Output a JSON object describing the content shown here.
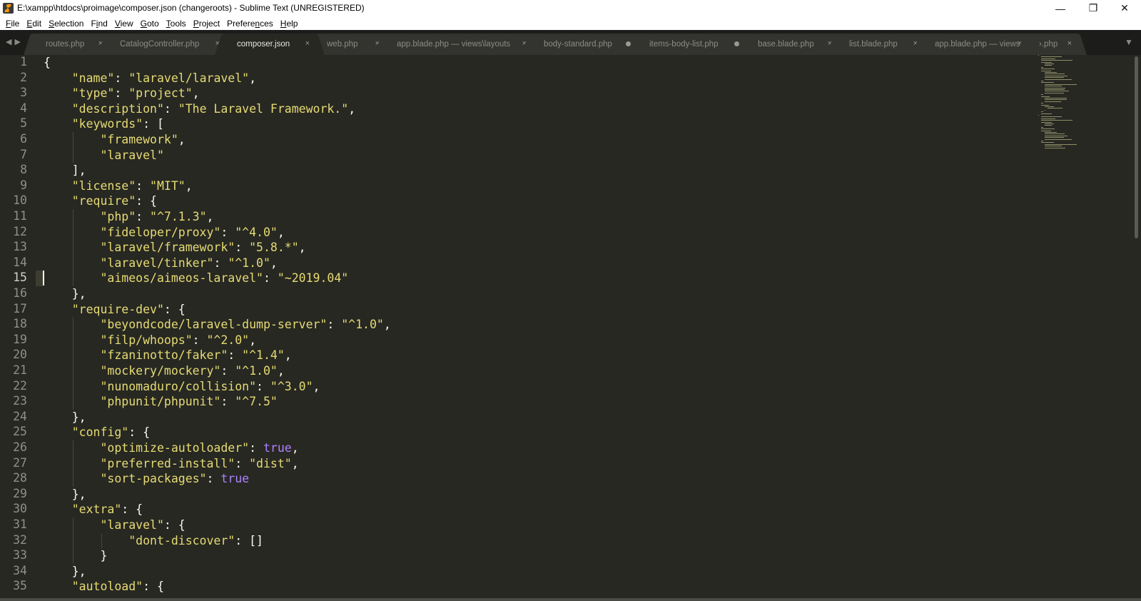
{
  "window": {
    "title": "E:\\xampp\\htdocs\\proimage\\composer.json (changeroots) - Sublime Text (UNREGISTERED)",
    "minimize": "—",
    "maximize": "❐",
    "close": "✕"
  },
  "menu": {
    "items": [
      {
        "u": "F",
        "rest": "ile"
      },
      {
        "u": "E",
        "rest": "dit"
      },
      {
        "u": "S",
        "rest": "election"
      },
      {
        "u": "",
        "pre": "F",
        "u2": "i",
        "rest": "nd"
      },
      {
        "u": "V",
        "rest": "iew"
      },
      {
        "u": "G",
        "rest": "oto"
      },
      {
        "u": "T",
        "rest": "ools"
      },
      {
        "u": "P",
        "rest": "roject"
      },
      {
        "u": "",
        "pre": "Prefere",
        "u2": "n",
        "rest": "ces"
      },
      {
        "u": "H",
        "rest": "elp"
      }
    ]
  },
  "tabs": [
    {
      "label": "routes.php",
      "state": "close",
      "width": 110
    },
    {
      "label": "CatalogController.php",
      "state": "close",
      "width": 170
    },
    {
      "label": "composer.json",
      "state": "close",
      "active": true,
      "width": 132
    },
    {
      "label": "web.php",
      "state": "close",
      "width": 104
    },
    {
      "label": "app.blade.php — views\\layouts",
      "state": "close",
      "width": 212
    },
    {
      "label": "body-standard.php",
      "state": "dirty",
      "width": 154
    },
    {
      "label": "items-body-list.php",
      "state": "dirty",
      "width": 158
    },
    {
      "label": "base.blade.php",
      "state": "close",
      "width": 134
    },
    {
      "label": "list.blade.php",
      "state": "close",
      "width": 126
    },
    {
      "label": "app.blade.php — views",
      "state": "close",
      "width": 152
    },
    {
      "label": "›.php",
      "state": "close",
      "width": 76
    }
  ],
  "tab_icons": {
    "close": "×",
    "left_arrow": "◀",
    "right_arrow": "▶",
    "overflow": "▼"
  },
  "editor": {
    "current_line": 15,
    "lines": [
      [
        [
          "k",
          "{"
        ]
      ],
      [
        [
          "k",
          "    "
        ],
        [
          "s",
          "\"name\""
        ],
        [
          "k",
          ": "
        ],
        [
          "s",
          "\"laravel/laravel\""
        ],
        [
          "k",
          ","
        ]
      ],
      [
        [
          "k",
          "    "
        ],
        [
          "s",
          "\"type\""
        ],
        [
          "k",
          ": "
        ],
        [
          "s",
          "\"project\""
        ],
        [
          "k",
          ","
        ]
      ],
      [
        [
          "k",
          "    "
        ],
        [
          "s",
          "\"description\""
        ],
        [
          "k",
          ": "
        ],
        [
          "s",
          "\"The Laravel Framework.\""
        ],
        [
          "k",
          ","
        ]
      ],
      [
        [
          "k",
          "    "
        ],
        [
          "s",
          "\"keywords\""
        ],
        [
          "k",
          ": ["
        ]
      ],
      [
        [
          "k",
          "        "
        ],
        [
          "s",
          "\"framework\""
        ],
        [
          "k",
          ","
        ]
      ],
      [
        [
          "k",
          "        "
        ],
        [
          "s",
          "\"laravel\""
        ]
      ],
      [
        [
          "k",
          "    ],"
        ]
      ],
      [
        [
          "k",
          "    "
        ],
        [
          "s",
          "\"license\""
        ],
        [
          "k",
          ": "
        ],
        [
          "s",
          "\"MIT\""
        ],
        [
          "k",
          ","
        ]
      ],
      [
        [
          "k",
          "    "
        ],
        [
          "s",
          "\"require\""
        ],
        [
          "k",
          ": {"
        ]
      ],
      [
        [
          "k",
          "        "
        ],
        [
          "s",
          "\"php\""
        ],
        [
          "k",
          ": "
        ],
        [
          "s",
          "\"^7.1.3\""
        ],
        [
          "k",
          ","
        ]
      ],
      [
        [
          "k",
          "        "
        ],
        [
          "s",
          "\"fideloper/proxy\""
        ],
        [
          "k",
          ": "
        ],
        [
          "s",
          "\"^4.0\""
        ],
        [
          "k",
          ","
        ]
      ],
      [
        [
          "k",
          "        "
        ],
        [
          "s",
          "\"laravel/framework\""
        ],
        [
          "k",
          ": "
        ],
        [
          "s",
          "\"5.8.*\""
        ],
        [
          "k",
          ","
        ]
      ],
      [
        [
          "k",
          "        "
        ],
        [
          "s",
          "\"laravel/tinker\""
        ],
        [
          "k",
          ": "
        ],
        [
          "s",
          "\"^1.0\""
        ],
        [
          "k",
          ","
        ]
      ],
      [
        [
          "k",
          "        "
        ],
        [
          "s",
          "\"aimeos/aimeos-laravel\""
        ],
        [
          "k",
          ": "
        ],
        [
          "s",
          "\"~2019.04\""
        ]
      ],
      [
        [
          "k",
          "    },"
        ]
      ],
      [
        [
          "k",
          "    "
        ],
        [
          "s",
          "\"require-dev\""
        ],
        [
          "k",
          ": {"
        ]
      ],
      [
        [
          "k",
          "        "
        ],
        [
          "s",
          "\"beyondcode/laravel-dump-server\""
        ],
        [
          "k",
          ": "
        ],
        [
          "s",
          "\"^1.0\""
        ],
        [
          "k",
          ","
        ]
      ],
      [
        [
          "k",
          "        "
        ],
        [
          "s",
          "\"filp/whoops\""
        ],
        [
          "k",
          ": "
        ],
        [
          "s",
          "\"^2.0\""
        ],
        [
          "k",
          ","
        ]
      ],
      [
        [
          "k",
          "        "
        ],
        [
          "s",
          "\"fzaninotto/faker\""
        ],
        [
          "k",
          ": "
        ],
        [
          "s",
          "\"^1.4\""
        ],
        [
          "k",
          ","
        ]
      ],
      [
        [
          "k",
          "        "
        ],
        [
          "s",
          "\"mockery/mockery\""
        ],
        [
          "k",
          ": "
        ],
        [
          "s",
          "\"^1.0\""
        ],
        [
          "k",
          ","
        ]
      ],
      [
        [
          "k",
          "        "
        ],
        [
          "s",
          "\"nunomaduro/collision\""
        ],
        [
          "k",
          ": "
        ],
        [
          "s",
          "\"^3.0\""
        ],
        [
          "k",
          ","
        ]
      ],
      [
        [
          "k",
          "        "
        ],
        [
          "s",
          "\"phpunit/phpunit\""
        ],
        [
          "k",
          ": "
        ],
        [
          "s",
          "\"^7.5\""
        ]
      ],
      [
        [
          "k",
          "    },"
        ]
      ],
      [
        [
          "k",
          "    "
        ],
        [
          "s",
          "\"config\""
        ],
        [
          "k",
          ": {"
        ]
      ],
      [
        [
          "k",
          "        "
        ],
        [
          "s",
          "\"optimize-autoloader\""
        ],
        [
          "k",
          ": "
        ],
        [
          "b",
          "true"
        ],
        [
          "k",
          ","
        ]
      ],
      [
        [
          "k",
          "        "
        ],
        [
          "s",
          "\"preferred-install\""
        ],
        [
          "k",
          ": "
        ],
        [
          "s",
          "\"dist\""
        ],
        [
          "k",
          ","
        ]
      ],
      [
        [
          "k",
          "        "
        ],
        [
          "s",
          "\"sort-packages\""
        ],
        [
          "k",
          ": "
        ],
        [
          "b",
          "true"
        ]
      ],
      [
        [
          "k",
          "    },"
        ]
      ],
      [
        [
          "k",
          "    "
        ],
        [
          "s",
          "\"extra\""
        ],
        [
          "k",
          ": {"
        ]
      ],
      [
        [
          "k",
          "        "
        ],
        [
          "s",
          "\"laravel\""
        ],
        [
          "k",
          ": {"
        ]
      ],
      [
        [
          "k",
          "            "
        ],
        [
          "s",
          "\"dont-discover\""
        ],
        [
          "k",
          ": []"
        ]
      ],
      [
        [
          "k",
          "        }"
        ]
      ],
      [
        [
          "k",
          "    },"
        ]
      ],
      [
        [
          "k",
          "    "
        ],
        [
          "s",
          "\"autoload\""
        ],
        [
          "k",
          ": {"
        ]
      ]
    ]
  },
  "colors": {
    "editor_bg": "#272822",
    "string": "#e6db74",
    "boolean": "#ae81ff",
    "text": "#f8f8f2"
  }
}
